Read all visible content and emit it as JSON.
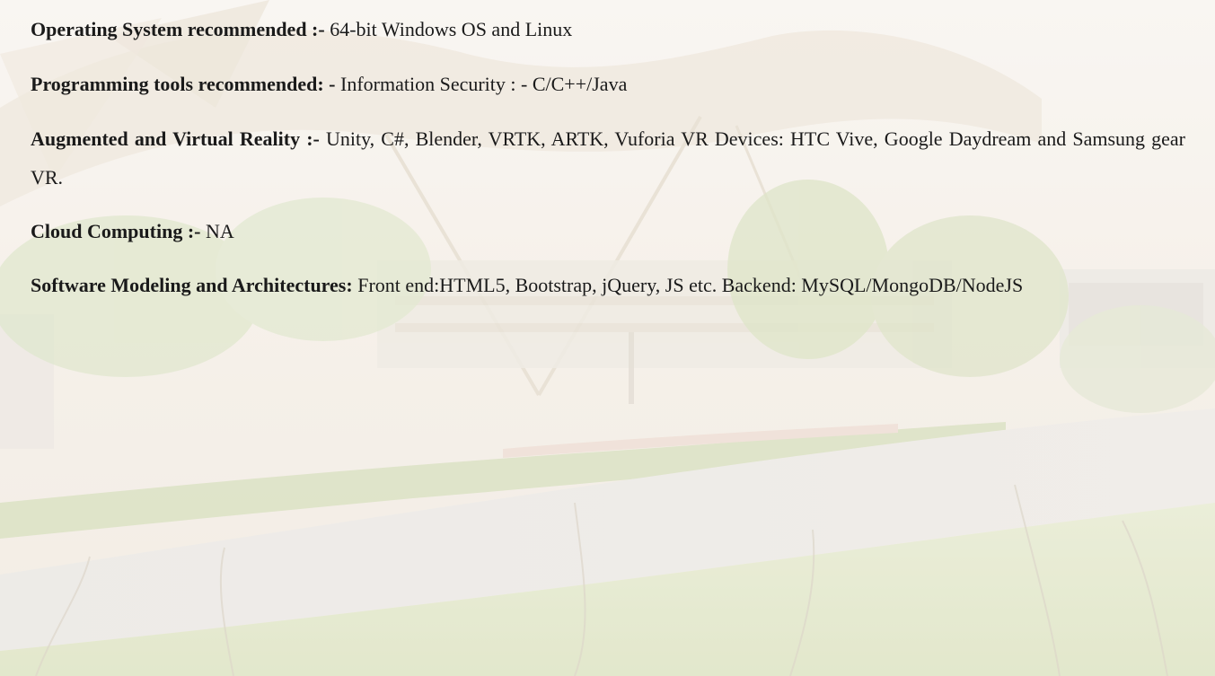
{
  "document": {
    "paragraphs": [
      {
        "heading": "Operating System recommended :-",
        "text": " 64-bit Windows OS and Linux"
      },
      {
        "heading": "Programming tools recommended: -",
        "text": " Information Security : - C/C++/Java"
      },
      {
        "heading": "Augmented and Virtual Reality :-",
        "text": " Unity, C#, Blender, VRTK, ARTK, Vuforia VR Devices: HTC Vive, Google Daydream and Samsung gear VR."
      },
      {
        "heading": "Cloud Computing :-",
        "text": " NA"
      },
      {
        "heading": "Software Modeling and Architectures:",
        "text": " Front end:HTML5, Bootstrap, jQuery, JS etc. Backend: MySQL/MongoDB/NodeJS"
      }
    ]
  },
  "background": {
    "palette": {
      "sky": "#f4ede4",
      "canopy": "#efe7de",
      "building": "#e8e2d8",
      "trees": "#cfd9b4",
      "road": "#e6e2dd",
      "grass": "#dfe5c4"
    }
  }
}
